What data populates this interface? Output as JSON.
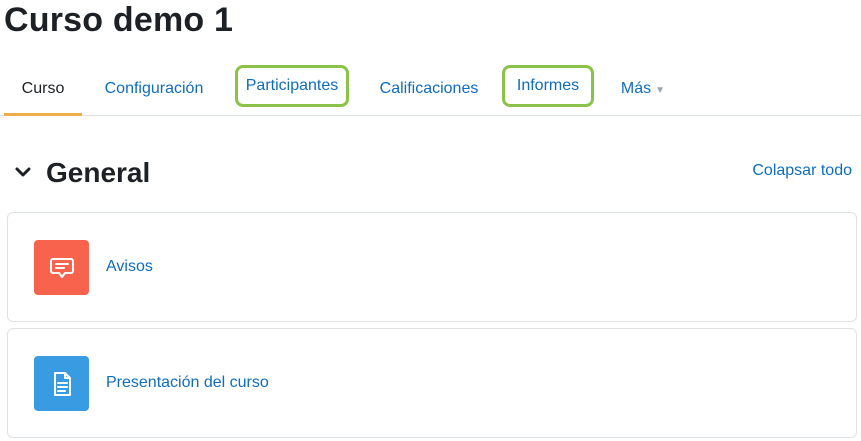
{
  "page": {
    "title": "Curso demo 1"
  },
  "tabs": [
    {
      "label": "Curso"
    },
    {
      "label": "Configuración"
    },
    {
      "label": "Participantes"
    },
    {
      "label": "Calificaciones"
    },
    {
      "label": "Informes"
    },
    {
      "label": "Más"
    }
  ],
  "section": {
    "title": "General",
    "collapse_all": "Colapsar todo"
  },
  "activities": [
    {
      "name": "Avisos",
      "icon": "forum-icon",
      "icon_color": "#f7634d"
    },
    {
      "name": "Presentación del curso",
      "icon": "page-icon",
      "icon_color": "#399be2"
    }
  ],
  "colors": {
    "link": "#0f6cbf",
    "active_tab_underline": "#f0ad4e",
    "highlight_outline": "#8bc34a"
  }
}
